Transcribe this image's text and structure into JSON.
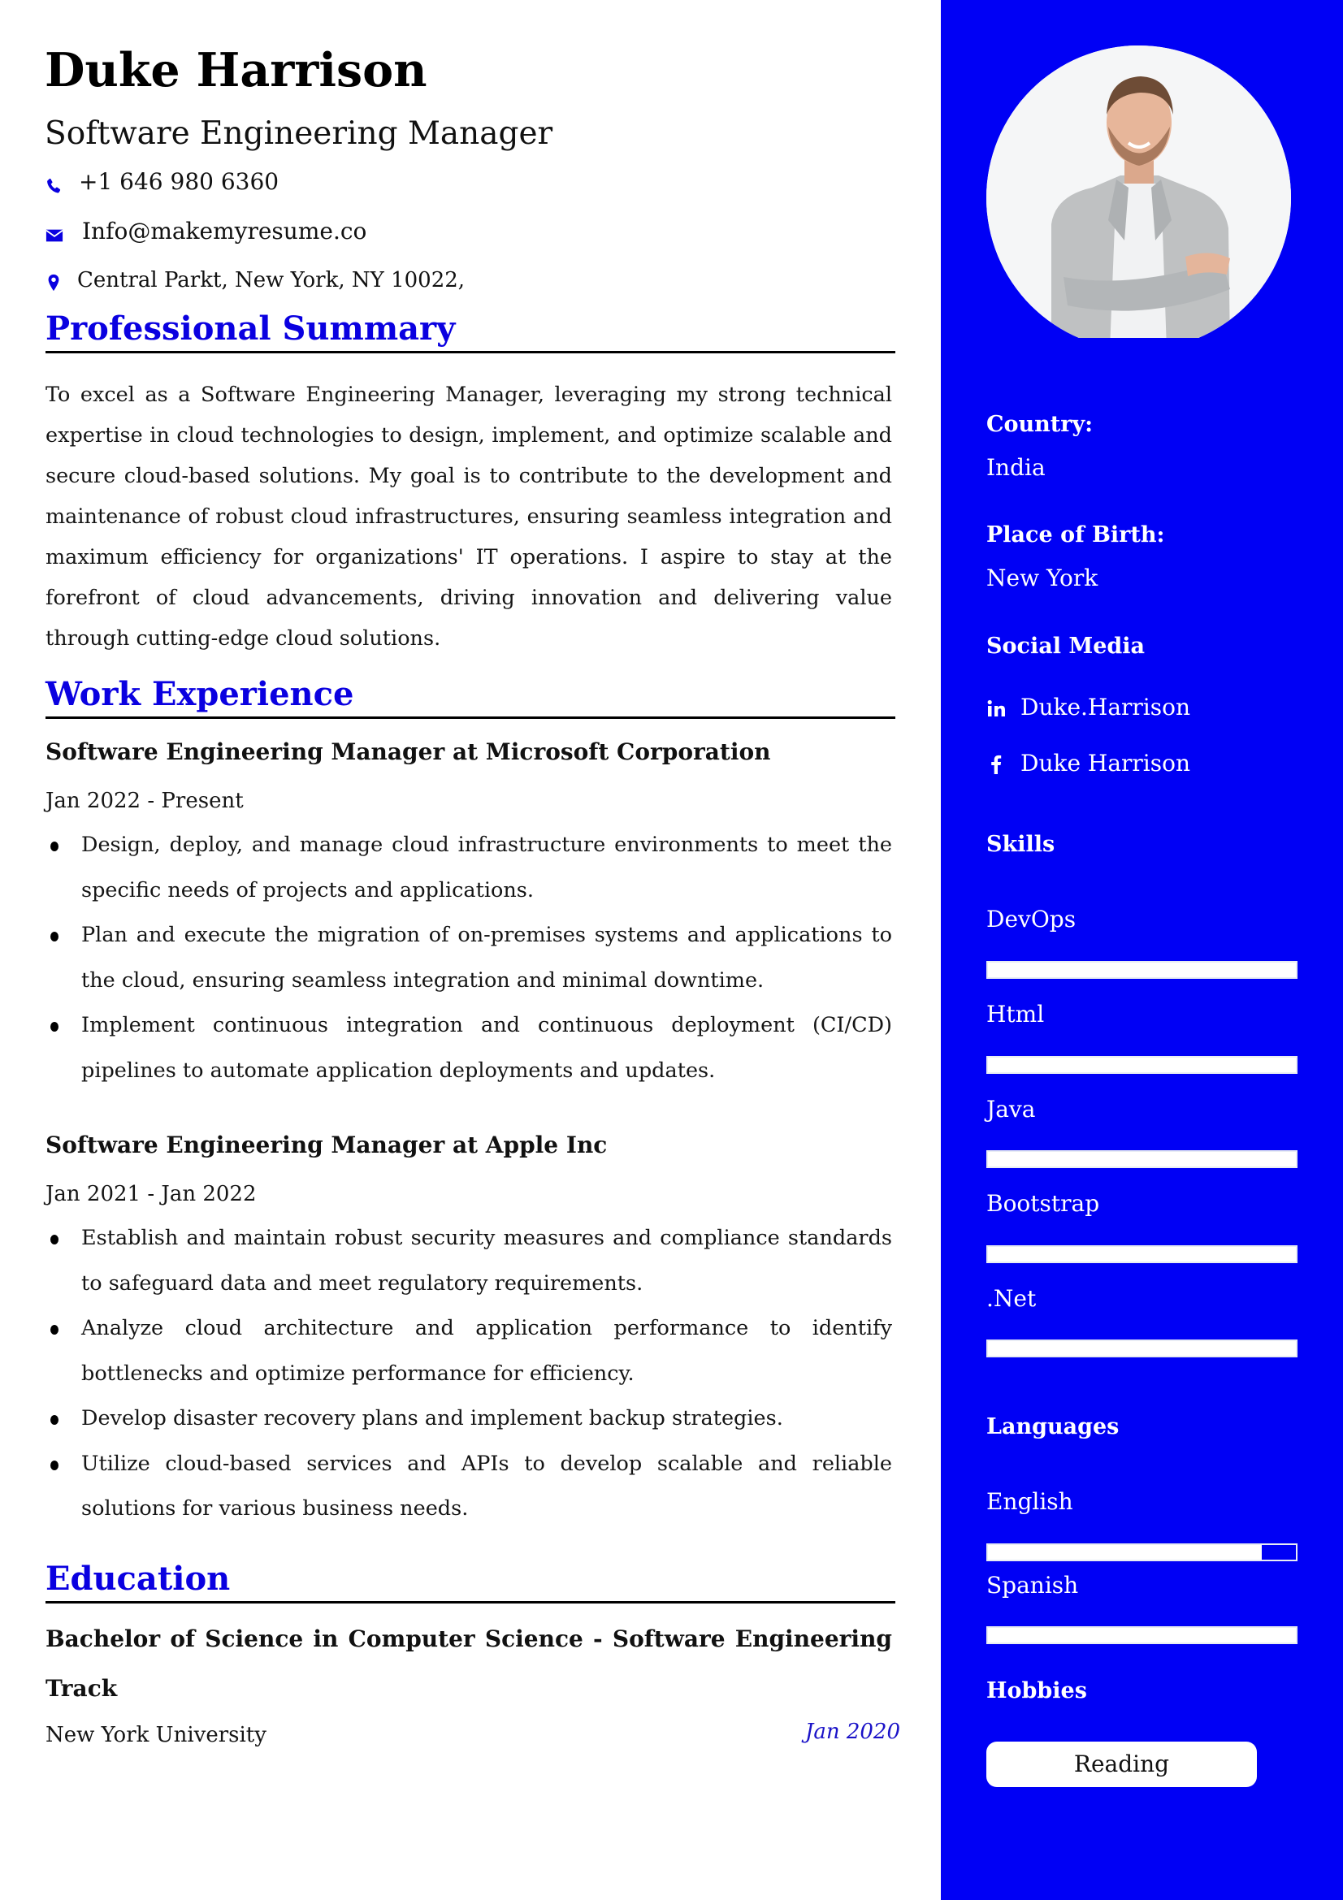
{
  "header": {
    "name": "Duke Harrison",
    "title": "Software Engineering Manager",
    "phone": "+1 646 980 6360",
    "email": "Info@makemyresume.co",
    "address": "Central Parkt, New York, NY 10022,"
  },
  "icons": {
    "phone": "phone-icon",
    "email": "envelope-icon",
    "address": "map-pin-icon",
    "linkedin": "linkedin-icon",
    "facebook": "facebook-icon"
  },
  "colors": {
    "accent": "#0a00e0",
    "sidebar": "#0000f5",
    "text": "#111111"
  },
  "summary": {
    "heading": "Professional Summary",
    "text": "To excel as a Software Engineering Manager, leveraging my strong technical expertise in cloud technologies to design, implement, and optimize scalable and secure cloud-based solutions. My goal is to contribute to the development and maintenance of robust cloud infrastructures, ensuring seamless integration and maximum efficiency for organizations' IT operations. I aspire to stay at the forefront of cloud advancements, driving innovation and delivering value through cutting-edge cloud solutions."
  },
  "work": {
    "heading": "Work Experience",
    "jobs": [
      {
        "title": "Software Engineering Manager at Microsoft Corporation",
        "dates": "Jan 2022 - Present",
        "bullets": [
          "Design, deploy, and manage cloud infrastructure environments to meet the specific needs of projects and applications.",
          "Plan and execute the migration of on-premises systems and applications to the cloud, ensuring seamless integration and minimal downtime.",
          "Implement continuous integration and continuous deployment (CI/CD) pipelines to automate application deployments and updates."
        ]
      },
      {
        "title": "Software Engineering Manager at Apple Inc",
        "dates": "Jan 2021 - Jan 2022",
        "bullets": [
          "Establish and maintain robust security measures and compliance standards to safeguard data and meet regulatory requirements.",
          "Analyze cloud architecture and application performance to identify bottlenecks and optimize performance for efficiency.",
          "Develop disaster recovery plans and implement backup strategies.",
          "Utilize cloud-based services and APIs to develop scalable and reliable solutions for various business needs."
        ]
      }
    ]
  },
  "education": {
    "heading": "Education",
    "degree": "Bachelor of Science in Computer Science - Software Engineering Track",
    "school": "New York University",
    "date": "Jan 2020"
  },
  "sidebar": {
    "country_label": "Country:",
    "country": "India",
    "birth_label": "Place of Birth:",
    "birth": "New York",
    "social_heading": "Social Media",
    "linkedin": "Duke.Harrison",
    "facebook": "Duke Harrison",
    "skills_heading": "Skills",
    "skills": [
      {
        "name": "DevOps",
        "level": 100
      },
      {
        "name": "Html",
        "level": 100
      },
      {
        "name": "Java",
        "level": 100
      },
      {
        "name": "Bootstrap",
        "level": 100
      },
      {
        "name": ".Net",
        "level": 100
      }
    ],
    "languages_heading": "Languages",
    "languages": [
      {
        "name": "English",
        "level": 89
      },
      {
        "name": "Spanish",
        "level": 100
      }
    ],
    "hobbies_heading": "Hobbies",
    "hobbies": [
      "Reading"
    ]
  }
}
